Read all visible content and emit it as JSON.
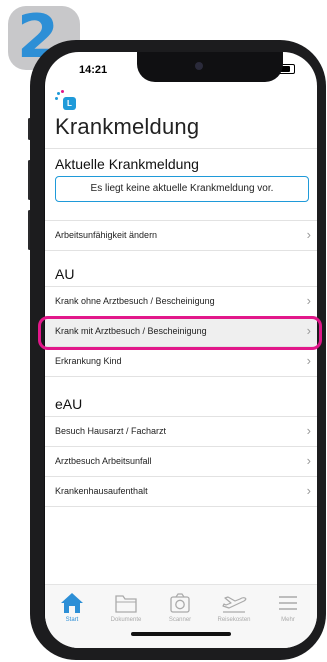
{
  "step": {
    "number": "2"
  },
  "status_bar": {
    "time": "14:21"
  },
  "app": {
    "logo_letter": "L",
    "title": "Krankmeldung"
  },
  "current": {
    "heading": "Aktuelle Krankmeldung",
    "notice": "Es liegt keine aktuelle Krankmeldung vor.",
    "change_label": "Arbeitsunfähigkeit ändern"
  },
  "au": {
    "heading": "AU",
    "items": [
      {
        "label": "Krank ohne Arztbesuch / Bescheinigung"
      },
      {
        "label": "Krank mit Arztbesuch / Bescheinigung"
      },
      {
        "label": "Erkrankung Kind"
      }
    ]
  },
  "eau": {
    "heading": "eAU",
    "items": [
      {
        "label": "Besuch Hausarzt / Facharzt"
      },
      {
        "label": "Arztbesuch Arbeitsunfall"
      },
      {
        "label": "Krankenhausaufenthalt"
      }
    ]
  },
  "tabs": [
    {
      "label": "Start",
      "icon": "home-icon",
      "active": true
    },
    {
      "label": "Dokumente",
      "icon": "folder-icon",
      "active": false
    },
    {
      "label": "Scanner",
      "icon": "camera-icon",
      "active": false
    },
    {
      "label": "Reisekosten",
      "icon": "plane-icon",
      "active": false
    },
    {
      "label": "Mehr",
      "icon": "menu-icon",
      "active": false
    }
  ],
  "colors": {
    "accent": "#2d8fd6",
    "highlight": "#e2178a",
    "logo": "#1f9ad9"
  }
}
